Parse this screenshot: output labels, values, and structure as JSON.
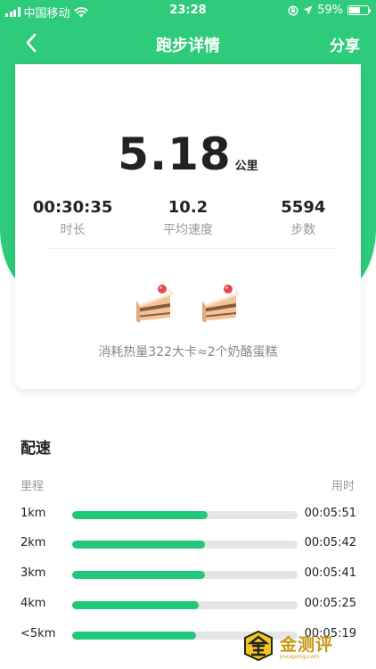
{
  "status_bar": {
    "carrier": "中国移动",
    "time": "23:28",
    "battery_text": "59%",
    "battery_level": 0.59
  },
  "nav": {
    "title": "跑步详情",
    "share": "分享",
    "back_icon": "chevron-left-icon"
  },
  "summary": {
    "distance": "5.18",
    "distance_unit": "公里",
    "stats": [
      {
        "value": "00:30:35",
        "label": "时长"
      },
      {
        "value": "10.2",
        "label": "平均速度"
      },
      {
        "value": "5594",
        "label": "步数"
      }
    ],
    "cake_icon": "cake-icon",
    "calorie_text": "消耗热量322大卡≈2个奶酪蛋糕"
  },
  "pace": {
    "title": "配速",
    "col_distance": "里程",
    "col_time": "用时",
    "rows": [
      {
        "km": "1km",
        "time": "00:05:51",
        "fill": 0.6
      },
      {
        "km": "2km",
        "time": "00:05:42",
        "fill": 0.59
      },
      {
        "km": "3km",
        "time": "00:05:41",
        "fill": 0.59
      },
      {
        "km": "4km",
        "time": "00:05:25",
        "fill": 0.56
      },
      {
        "km": "<5km",
        "time": "00:05:19",
        "fill": 0.55
      }
    ]
  },
  "watermark": {
    "text": "金测评",
    "sub": "jincepimg.com"
  },
  "colors": {
    "accent": "#2ecc7a",
    "bar": "#21c77a",
    "watermark": "#c99612"
  }
}
